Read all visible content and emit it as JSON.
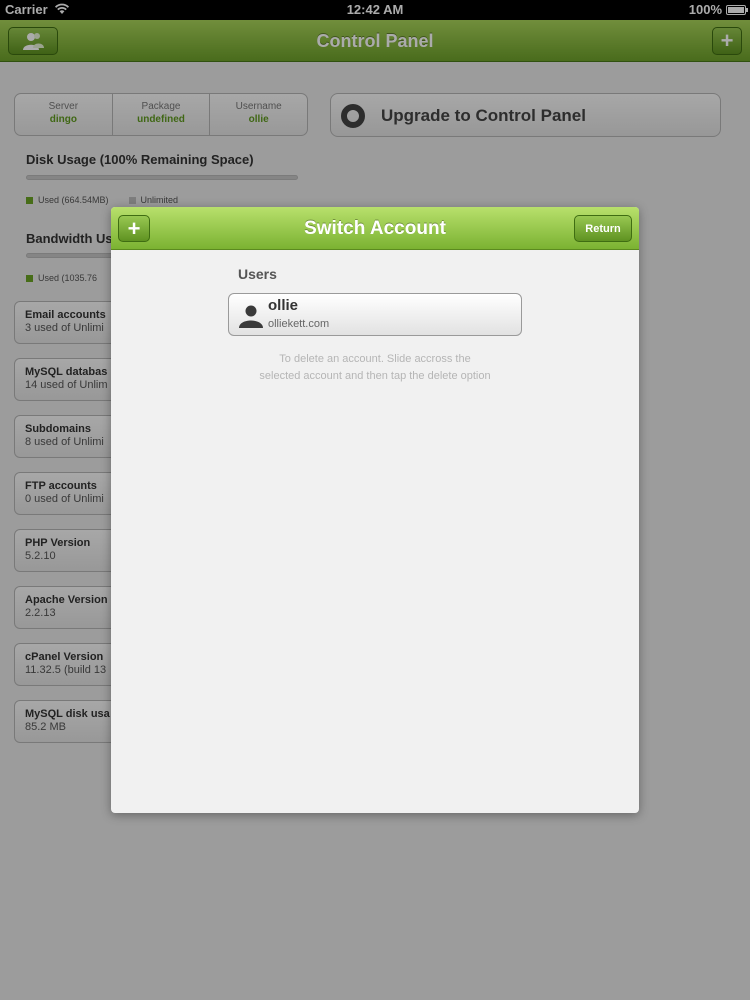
{
  "status_bar": {
    "carrier": "Carrier",
    "time": "12:42 AM",
    "battery": "100%"
  },
  "nav": {
    "title": "Control Panel",
    "add_label": "+",
    "left_icon": "accounts-icon"
  },
  "account_info": [
    {
      "label": "Server",
      "value": "dingo"
    },
    {
      "label": "Package",
      "value": "undefined"
    },
    {
      "label": "Username",
      "value": "ollie"
    }
  ],
  "upgrade": {
    "label": "Upgrade to Control Panel",
    "icon": "lifebuoy-icon"
  },
  "disk": {
    "title": "Disk Usage (100% Remaining Space)",
    "used": "Used (664.54MB)",
    "limit": "Unlimited"
  },
  "bandwidth": {
    "title": "Bandwidth Us",
    "used": "Used (1035.76"
  },
  "stats": [
    {
      "name": "Email accounts",
      "value": "3 used of Unlimi"
    },
    {
      "name": "MySQL databas",
      "value": "14 used of Unlim"
    },
    {
      "name": "Subdomains",
      "value": "8 used of Unlimi"
    },
    {
      "name": "FTP accounts",
      "value": "0 used of Unlimi"
    },
    {
      "name": "PHP Version",
      "value": "5.2.10"
    },
    {
      "name": "Apache Version",
      "value": "2.2.13"
    },
    {
      "name": "cPanel Version",
      "value": "11.32.5 (build 13"
    },
    {
      "name": "MySQL disk usa",
      "value": "85.2 MB"
    }
  ],
  "modal": {
    "title": "Switch Account",
    "add_label": "+",
    "return_label": "Return",
    "section_label": "Users",
    "accounts": [
      {
        "name": "ollie",
        "domain": "olliekett.com",
        "icon": "person-icon"
      }
    ],
    "hint_line1": "To delete an account. Slide accross the",
    "hint_line2": "selected account and then tap the delete option"
  },
  "colors": {
    "accent": "#7bb232",
    "value_green": "#5f9a1e"
  }
}
